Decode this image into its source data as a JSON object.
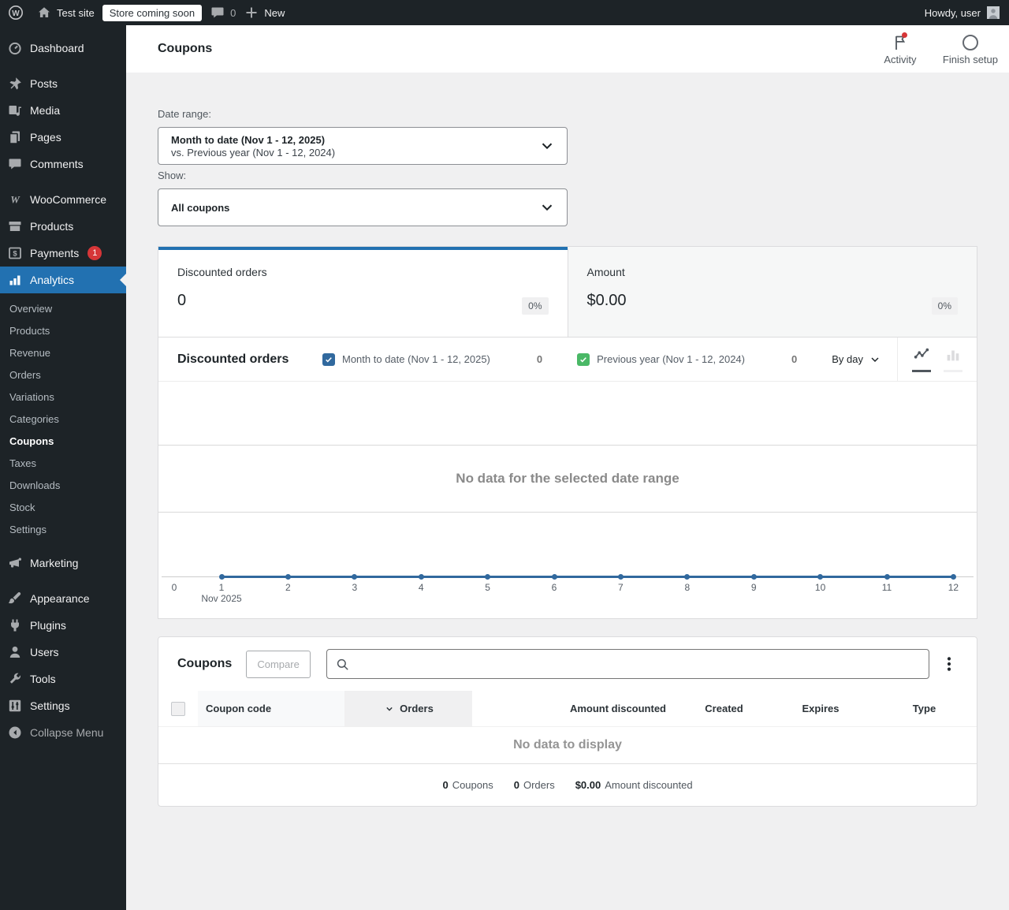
{
  "colors": {
    "accent_blue": "#2271b1",
    "chart_primary": "#31699e",
    "chart_secondary": "#4ab866",
    "notification_red": "#d63638"
  },
  "admin_bar": {
    "site_name": "Test site",
    "store_badge": "Store coming soon",
    "comments_count": "0",
    "new_label": "New",
    "howdy_text": "Howdy, user"
  },
  "sidebar": {
    "items": [
      {
        "key": "dashboard",
        "label": "Dashboard",
        "icon": "dashboard-icon"
      },
      {
        "key": "posts",
        "label": "Posts",
        "icon": "posts-icon",
        "separator_before": true
      },
      {
        "key": "media",
        "label": "Media",
        "icon": "media-icon"
      },
      {
        "key": "pages",
        "label": "Pages",
        "icon": "pages-icon"
      },
      {
        "key": "comments",
        "label": "Comments",
        "icon": "comments-icon"
      },
      {
        "key": "woocommerce",
        "label": "WooCommerce",
        "icon": "woocommerce-icon",
        "separator_before": true
      },
      {
        "key": "products",
        "label": "Products",
        "icon": "products-icon"
      },
      {
        "key": "payments",
        "label": "Payments",
        "icon": "payments-icon",
        "badge": "1"
      },
      {
        "key": "analytics",
        "label": "Analytics",
        "icon": "analytics-icon",
        "active": true,
        "submenu": [
          {
            "label": "Overview"
          },
          {
            "label": "Products"
          },
          {
            "label": "Revenue"
          },
          {
            "label": "Orders"
          },
          {
            "label": "Variations"
          },
          {
            "label": "Categories"
          },
          {
            "label": "Coupons",
            "current": true
          },
          {
            "label": "Taxes"
          },
          {
            "label": "Downloads"
          },
          {
            "label": "Stock"
          },
          {
            "label": "Settings"
          }
        ]
      },
      {
        "key": "marketing",
        "label": "Marketing",
        "icon": "marketing-icon"
      },
      {
        "key": "appearance",
        "label": "Appearance",
        "icon": "appearance-icon",
        "separator_before": true
      },
      {
        "key": "plugins",
        "label": "Plugins",
        "icon": "plugins-icon"
      },
      {
        "key": "users",
        "label": "Users",
        "icon": "users-icon"
      },
      {
        "key": "tools",
        "label": "Tools",
        "icon": "tools-icon"
      },
      {
        "key": "settings",
        "label": "Settings",
        "icon": "settings-icon"
      },
      {
        "key": "collapse-menu",
        "label": "Collapse Menu",
        "icon": "collapse-icon"
      }
    ]
  },
  "header": {
    "title": "Coupons",
    "activity_label": "Activity",
    "finish_setup_label": "Finish setup"
  },
  "filters": {
    "date_range_label": "Date range:",
    "date_range_value_primary": "Month to date (Nov 1 - 12, 2025)",
    "date_range_value_secondary": "vs. Previous year (Nov 1 - 12, 2024)",
    "show_label": "Show:",
    "show_value": "All coupons"
  },
  "summary_tiles": [
    {
      "label": "Discounted orders",
      "value": "0",
      "delta": "0%",
      "selected": true
    },
    {
      "label": "Amount",
      "value": "$0.00",
      "delta": "0%",
      "selected": false
    }
  ],
  "chart": {
    "title": "Discounted orders",
    "interval_label": "By day",
    "empty_message": "No data for the selected date range",
    "legend": [
      {
        "label": "Month to date (Nov 1 - 12, 2025)",
        "value": "0",
        "color": "#31699e",
        "checked": true
      },
      {
        "label": "Previous year (Nov 1 - 12, 2024)",
        "value": "0",
        "color": "#4ab866",
        "checked": true
      }
    ]
  },
  "chart_data": {
    "type": "line",
    "title": "Discounted orders",
    "interval": "day",
    "x_ticks": [
      "0",
      "1",
      "2",
      "3",
      "4",
      "5",
      "6",
      "7",
      "8",
      "9",
      "10",
      "11",
      "12"
    ],
    "x_sub_label": "Nov 2025",
    "x": [
      1,
      2,
      3,
      4,
      5,
      6,
      7,
      8,
      9,
      10,
      11,
      12
    ],
    "series": [
      {
        "name": "Month to date (Nov 1 - 12, 2025)",
        "values": [
          0,
          0,
          0,
          0,
          0,
          0,
          0,
          0,
          0,
          0,
          0,
          0
        ],
        "color": "#31699e"
      },
      {
        "name": "Previous year (Nov 1 - 12, 2024)",
        "values": [
          0,
          0,
          0,
          0,
          0,
          0,
          0,
          0,
          0,
          0,
          0,
          0
        ],
        "color": "#4ab866"
      }
    ],
    "ylim": [
      0,
      1
    ],
    "empty_message": "No data for the selected date range"
  },
  "table": {
    "title": "Coupons",
    "compare_label": "Compare",
    "search_placeholder": "",
    "columns": [
      "Coupon code",
      "Orders",
      "Amount discounted",
      "Created",
      "Expires",
      "Type"
    ],
    "sorted_column": "Orders",
    "empty_message": "No data to display",
    "summary": [
      {
        "value": "0",
        "label": "Coupons"
      },
      {
        "value": "0",
        "label": "Orders"
      },
      {
        "value": "$0.00",
        "label": "Amount discounted"
      }
    ]
  }
}
